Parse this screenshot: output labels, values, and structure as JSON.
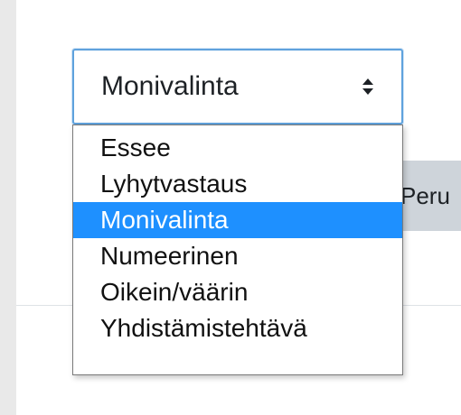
{
  "question_type_select": {
    "selected_value": "Monivalinta",
    "options": [
      {
        "label": "Essee",
        "selected": false
      },
      {
        "label": "Lyhytvastaus",
        "selected": false
      },
      {
        "label": "Monivalinta",
        "selected": true
      },
      {
        "label": "Numeerinen",
        "selected": false
      },
      {
        "label": "Oikein/väärin",
        "selected": false
      },
      {
        "label": "Yhdistämistehtävä",
        "selected": false
      }
    ]
  },
  "buttons": {
    "cancel_label": "Peru"
  },
  "colors": {
    "focus_border": "#5fa2dd",
    "selected_option_bg": "#1e90ff",
    "cancel_button_bg": "#ced4da",
    "page_strip_bg": "#e9e9e9"
  },
  "icons": {
    "select_arrow": "updown-chevron-icon"
  }
}
